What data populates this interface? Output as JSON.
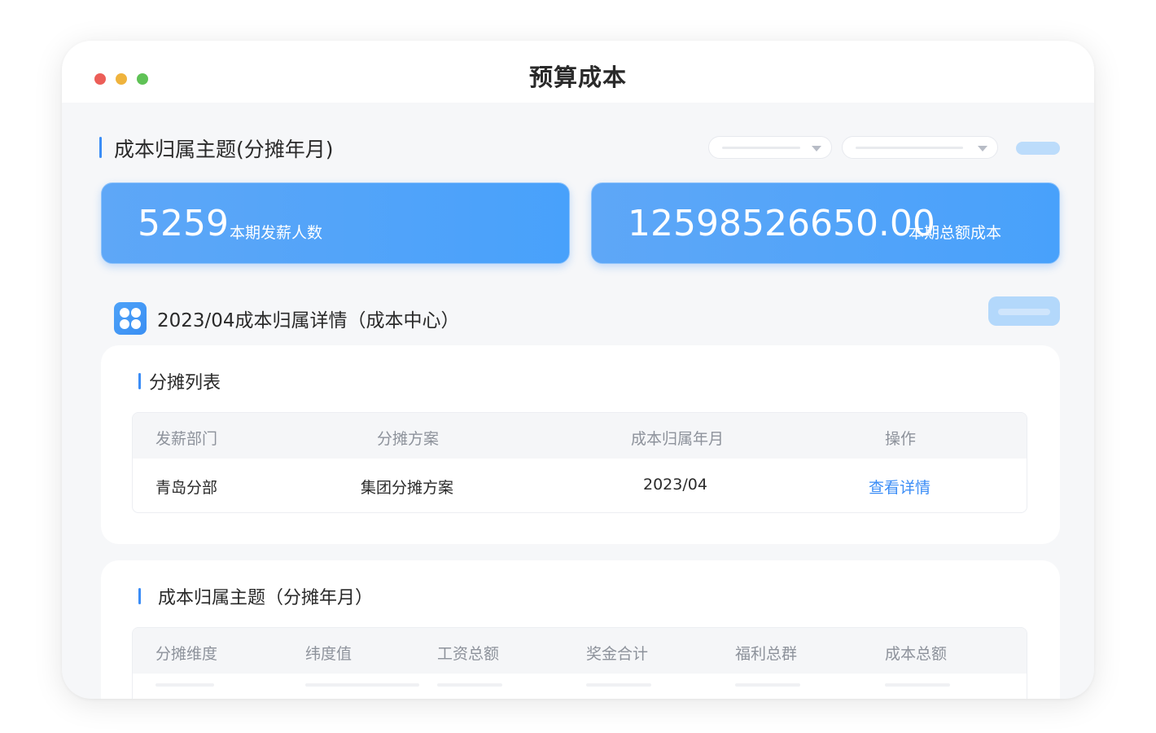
{
  "window": {
    "title": "预算成本"
  },
  "theme": {
    "accent": "#3b8df6",
    "kpi_blue": "#48a1fb"
  },
  "header_section": {
    "title": "成本归属主题(分摊年月)"
  },
  "kpis": [
    {
      "value": "5259",
      "label": "本期发薪人数"
    },
    {
      "value": "12598526650.00",
      "label": "本期总额成本"
    }
  ],
  "detail": {
    "title": "2023/04成本归属详情（成本中心）",
    "icon": "clover-grid-icon"
  },
  "allocation_list": {
    "title": "分摊列表",
    "columns": [
      "发薪部门",
      "分摊方案",
      "成本归属年月",
      "操作"
    ],
    "rows": [
      {
        "department": "青岛分部",
        "scheme": "集团分摊方案",
        "month": "2023/04",
        "action": "查看详情"
      }
    ]
  },
  "attribution_table": {
    "title": "成本归属主题（分摊年月）",
    "columns": [
      "分摊维度",
      "纬度值",
      "工资总额",
      "奖金合计",
      "福利总群",
      "成本总额"
    ]
  }
}
